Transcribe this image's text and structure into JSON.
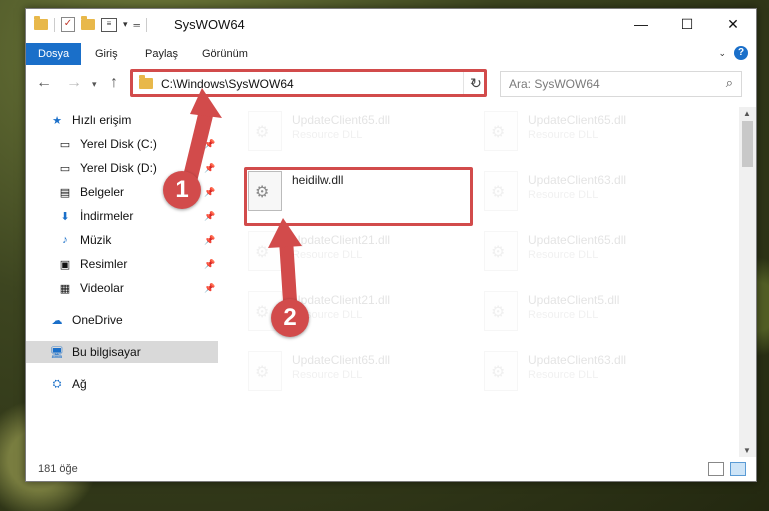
{
  "window": {
    "title": "SysWOW64",
    "controls": {
      "minimize": "—",
      "maximize": "☐",
      "close": "✕"
    }
  },
  "ribbon": {
    "tabs": [
      "Dosya",
      "Giriş",
      "Paylaş",
      "Görünüm"
    ],
    "help": "?"
  },
  "nav": {
    "address": "C:\\Windows\\SysWOW64",
    "search_placeholder": "Ara: SysWOW64"
  },
  "sidebar": {
    "items": [
      {
        "label": "Hızlı erişim",
        "icon": "star-icon"
      },
      {
        "label": "Yerel Disk (C:)",
        "icon": "drive-icon",
        "pinned": true
      },
      {
        "label": "Yerel Disk (D:)",
        "icon": "drive-icon",
        "pinned": true
      },
      {
        "label": "Belgeler",
        "icon": "documents-icon",
        "pinned": true
      },
      {
        "label": "İndirmeler",
        "icon": "download-icon",
        "pinned": true
      },
      {
        "label": "Müzik",
        "icon": "music-icon",
        "pinned": true
      },
      {
        "label": "Resimler",
        "icon": "pictures-icon",
        "pinned": true
      },
      {
        "label": "Videolar",
        "icon": "videos-icon",
        "pinned": true
      },
      {
        "label": "OneDrive",
        "icon": "cloud-icon"
      },
      {
        "label": "Bu bilgisayar",
        "icon": "computer-icon",
        "selected": true
      },
      {
        "label": "Ağ",
        "icon": "network-icon"
      }
    ]
  },
  "files": {
    "highlighted": {
      "name": "heidilw.dll"
    },
    "col1": [
      {
        "name": "UpdateClient65.dll",
        "type": "Resource DLL"
      },
      {
        "name": "UpdateClient21.dll",
        "type": "Resource DLL"
      },
      {
        "name": "UpdateClient21.dll",
        "type": "Resource DLL"
      },
      {
        "name": "UpdateClient65.dll",
        "type": "Resource DLL"
      }
    ],
    "col2": [
      {
        "name": "UpdateClient65.dll",
        "type": "Resource DLL"
      },
      {
        "name": "UpdateClient63.dll",
        "type": "Resource DLL"
      },
      {
        "name": "UpdateClient65.dll",
        "type": "Resource DLL"
      },
      {
        "name": "UpdateClient5.dll",
        "type": "Resource DLL"
      },
      {
        "name": "UpdateClient63.dll",
        "type": "Resource DLL"
      }
    ]
  },
  "status": {
    "count": "181 öğe"
  },
  "callouts": {
    "one": "1",
    "two": "2"
  },
  "colors": {
    "accent": "#1a6fc9",
    "highlight": "#d24b4b"
  }
}
